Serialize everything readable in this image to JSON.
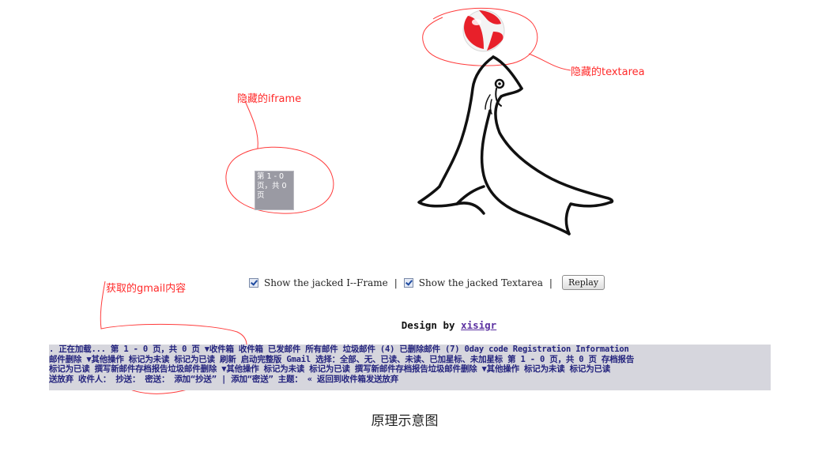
{
  "annotations": {
    "hidden_iframe": "隐藏的iframe",
    "hidden_textarea": "隐藏的textarea",
    "gmail_content": "获取的gmail内容"
  },
  "iframe_preview_text": "第 1 - 0 页，共 0 页",
  "controls": {
    "show_iframe_label": "Show the jacked I--Frame",
    "separator_1": "|",
    "show_textarea_label": "Show the jacked Textarea",
    "separator_2": "|",
    "replay_label": "Replay",
    "show_iframe_checked": true,
    "show_textarea_checked": true
  },
  "credit": {
    "prefix": "Design by",
    "author": "xisigr"
  },
  "gmail_lines": [
    ". 正在加载... 第 1 - 0 页，共 0 页 ▼收件箱 收件箱 已发邮件 所有邮件 垃圾邮件 (4) 已删除邮件 (7) 0day code Registration Information",
    "邮件删除 ▼其他操作 标记为未读 标记为已读 刷新 启动完整版 Gmail 选择：全部、无、已读、未读、已加星标、未加星标 第 1 - 0 页，共 0 页 存档报告",
    " 标记为已读 撰写新邮件存档报告垃圾邮件删除 ▼其他操作 标记为未读 标记为已读 撰写新邮件存档报告垃圾邮件删除 ▼其他操作 标记为未读 标记为已读",
    "送放弃 收件人： 抄送： 密送： 添加“抄送” | 添加“密送” 主题： « 返回到收件箱发送放弃"
  ],
  "caption": "原理示意图",
  "colors": {
    "annotation": "#ff2a2a",
    "ball_red": "#e8202a",
    "gmail_text": "#24247e",
    "gmail_bg": "#d6d6dd",
    "link": "#5a2fa0"
  }
}
